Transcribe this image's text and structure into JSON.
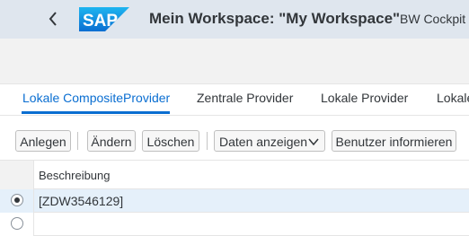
{
  "shell": {
    "title": "Mein Workspace: \"My Workspace\"",
    "subtitle": "BW Cockpit",
    "logo_text": "SAP",
    "brand_color": "#0a6ed1"
  },
  "tabs": [
    {
      "label": "Lokale CompositeProvider",
      "active": true
    },
    {
      "label": "Zentrale Provider",
      "active": false
    },
    {
      "label": "Lokale Provider",
      "active": false
    },
    {
      "label": "Lokale",
      "active": false
    }
  ],
  "toolbar": {
    "create_label": "Anlegen",
    "change_label": "Ändern",
    "delete_label": "Löschen",
    "display_label": "Daten anzeigen",
    "inform_label": "Benutzer informieren"
  },
  "table": {
    "column_header": "Beschreibung",
    "rows": [
      {
        "value": "[ZDW3546129]",
        "selected": true
      },
      {
        "value": "",
        "selected": false
      }
    ]
  }
}
